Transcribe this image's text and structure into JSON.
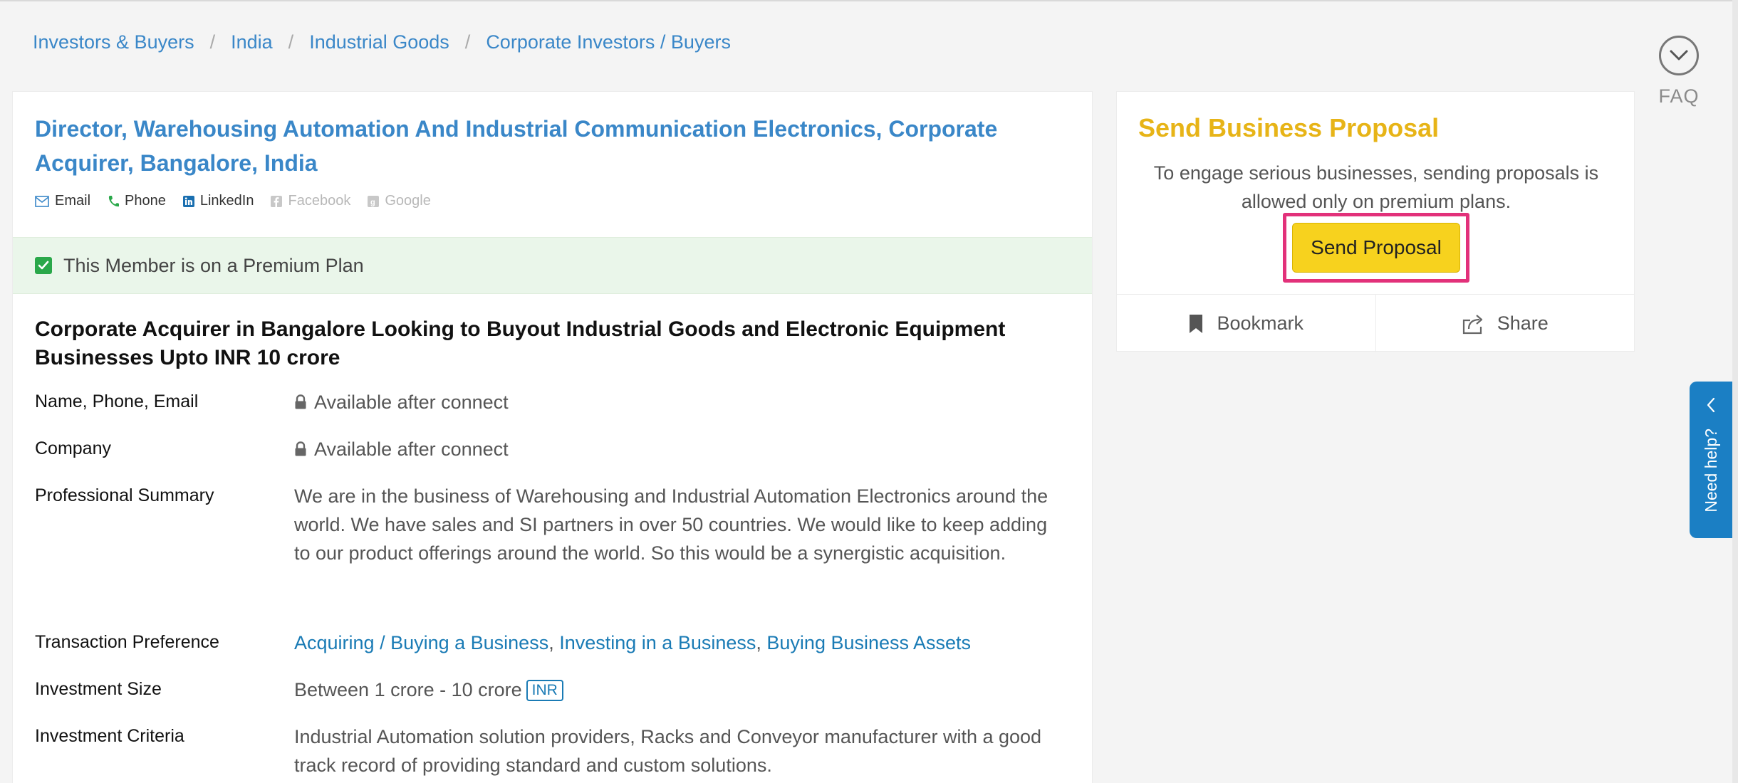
{
  "breadcrumb": [
    {
      "label": "Investors & Buyers"
    },
    {
      "label": "India"
    },
    {
      "label": "Industrial Goods"
    },
    {
      "label": "Corporate Investors / Buyers"
    }
  ],
  "faq": {
    "label": "FAQ",
    "icon": "chevron-down-icon"
  },
  "profile": {
    "title": "Director, Warehousing Automation And Industrial Communication Electronics, Corporate Acquirer, Bangalore, India",
    "contacts": {
      "email": "Email",
      "phone": "Phone",
      "linkedin": "LinkedIn",
      "facebook": "Facebook",
      "google": "Google"
    },
    "premium_notice": "This Member is on a Premium Plan",
    "headline": "Corporate Acquirer in Bangalore Looking to Buyout Industrial Goods and Electronic Equipment Businesses Upto INR 10 crore",
    "fields": {
      "name_label": "Name, Phone, Email",
      "name_value": "Available after connect",
      "company_label": "Company",
      "company_value": "Available after connect",
      "summary_label": "Professional Summary",
      "summary_value": "We are in the business of Warehousing and Industrial Automation Electronics around the world. We have sales and SI partners in over 50 countries. We would like to keep adding to our product offerings around the world. So this would be a synergistic acquisition.",
      "transaction_label": "Transaction Preference",
      "transaction_values": [
        "Acquiring / Buying a Business",
        "Investing in a Business",
        "Buying Business Assets"
      ],
      "transaction_sep": ", ",
      "investment_size_label": "Investment Size",
      "investment_size_value": "Between 1 crore - 10 crore",
      "currency_badge": "INR",
      "criteria_label": "Investment Criteria",
      "criteria_value": "Industrial Automation solution providers, Racks and Conveyor manufacturer with a good track record of providing standard and custom solutions."
    }
  },
  "proposal": {
    "title": "Send Business Proposal",
    "text": "To engage serious businesses, sending proposals is allowed only on premium plans.",
    "button": "Send Proposal",
    "bookmark": "Bookmark",
    "share": "Share"
  },
  "help": {
    "label": "Need help?"
  },
  "colors": {
    "link": "#3a87c8",
    "accent_yellow": "#f7d21e",
    "highlight_border": "#e2317a",
    "help_tab": "#1b7fc4",
    "premium_bg": "#eaf6ea"
  }
}
